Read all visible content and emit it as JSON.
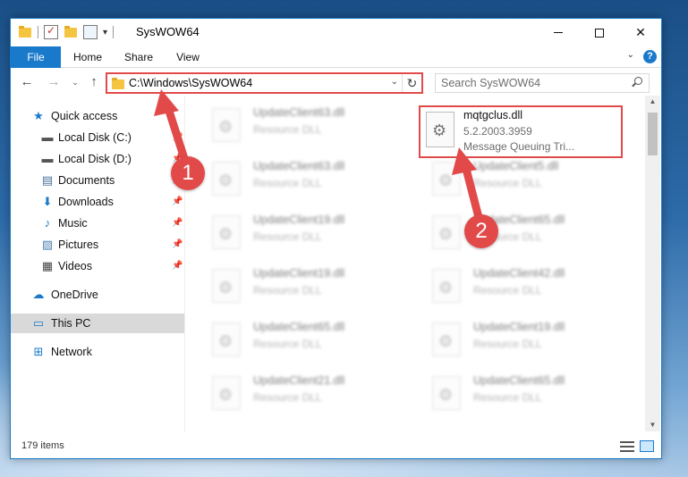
{
  "window": {
    "title": "SysWOW64",
    "minimize_glyph": "",
    "maximize_glyph": "",
    "close_glyph": "✕"
  },
  "ribbon": {
    "tabs": [
      "File",
      "Home",
      "Share",
      "View"
    ],
    "help": "?"
  },
  "nav": {
    "back": "←",
    "forward": "→",
    "up": "↑",
    "address": "C:\\Windows\\SysWOW64",
    "refresh": "↻",
    "search_placeholder": "Search SysWOW64"
  },
  "sidebar": {
    "items": [
      {
        "label": "Quick access",
        "icon": "★",
        "pinned": false
      },
      {
        "label": "Local Disk (C:)",
        "icon": "▬",
        "pinned": true
      },
      {
        "label": "Local Disk (D:)",
        "icon": "▬",
        "pinned": true
      },
      {
        "label": "Documents",
        "icon": "▤",
        "pinned": true
      },
      {
        "label": "Downloads",
        "icon": "⬇",
        "pinned": true
      },
      {
        "label": "Music",
        "icon": "♪",
        "pinned": true
      },
      {
        "label": "Pictures",
        "icon": "▨",
        "pinned": true
      },
      {
        "label": "Videos",
        "icon": "▦",
        "pinned": true
      },
      {
        "label": "OneDrive",
        "icon": "☁",
        "pinned": false
      },
      {
        "label": "This PC",
        "icon": "▭",
        "pinned": false
      },
      {
        "label": "Network",
        "icon": "⊞",
        "pinned": false
      }
    ],
    "pin_glyph": "📌"
  },
  "files": {
    "target": {
      "name": "mqtgclus.dll",
      "version": "5.2.2003.3959",
      "description": "Message Queuing Tri..."
    },
    "left_column": [
      {
        "name": "UpdateClient63.dll",
        "type": "Resource DLL"
      },
      {
        "name": "UpdateClient63.dll",
        "type": "Resource DLL"
      },
      {
        "name": "UpdateClient19.dll",
        "type": "Resource DLL"
      },
      {
        "name": "UpdateClient19.dll",
        "type": "Resource DLL"
      },
      {
        "name": "UpdateClient65.dll",
        "type": "Resource DLL"
      },
      {
        "name": "UpdateClient21.dll",
        "type": "Resource DLL"
      }
    ],
    "right_column": [
      {
        "name": "UpdateClient5.dll",
        "type": "Resource DLL"
      },
      {
        "name": "UpdateClient65.dll",
        "type": "Resource DLL"
      },
      {
        "name": "UpdateClient42.dll",
        "type": "Resource DLL"
      },
      {
        "name": "UpdateClient19.dll",
        "type": "Resource DLL"
      },
      {
        "name": "UpdateClient65.dll",
        "type": "Resource DLL"
      }
    ]
  },
  "status": {
    "item_count": "179 items"
  },
  "annotations": {
    "marker1": "1",
    "marker2": "2",
    "color": "#e24a4a"
  },
  "colors": {
    "accent": "#1979ca",
    "selection": "#cce8ff"
  }
}
